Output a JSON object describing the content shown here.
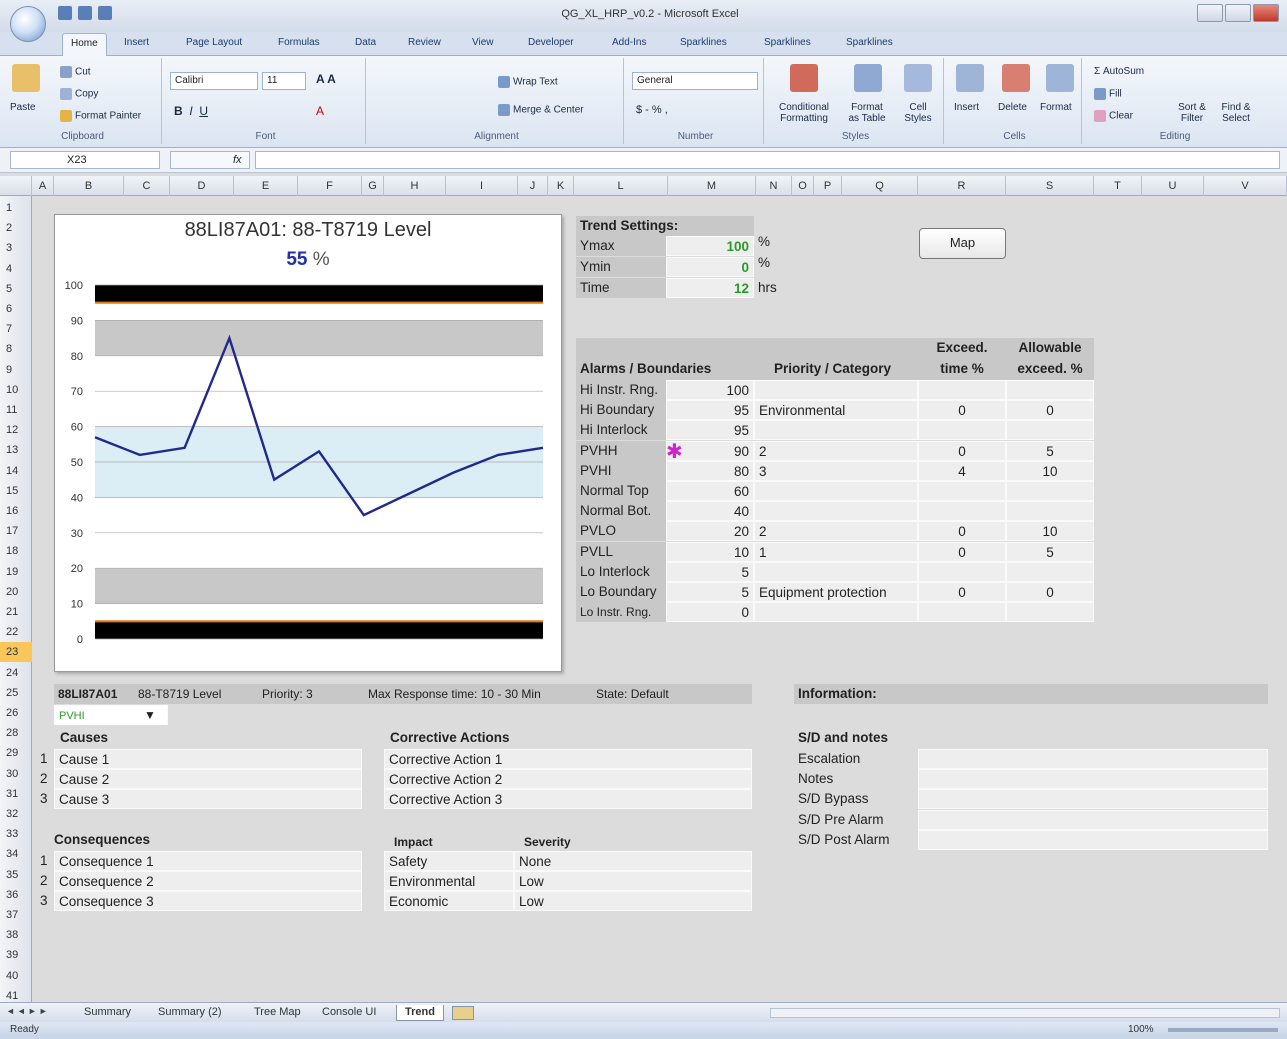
{
  "window": {
    "title": "QG_XL_HRP_v0.2 - Microsoft Excel"
  },
  "ribbon_tabs": [
    "Home",
    "Insert",
    "Page Layout",
    "Formulas",
    "Data",
    "Review",
    "View",
    "Developer",
    "Add-Ins",
    "Sparklines",
    "Sparklines",
    "Sparklines"
  ],
  "ribbon": {
    "clipboard": {
      "paste": "Paste",
      "cut": "Cut",
      "copy": "Copy",
      "format_painter": "Format Painter",
      "label": "Clipboard"
    },
    "font": {
      "name": "Calibri",
      "size": "11",
      "label": "Font"
    },
    "alignment": {
      "wrap": "Wrap Text",
      "merge": "Merge & Center",
      "label": "Alignment"
    },
    "number": {
      "format": "General",
      "label": "Number"
    },
    "styles": {
      "cond": "Conditional",
      "cond2": "Formatting",
      "fmt": "Format",
      "fmt2": "as Table",
      "cell": "Cell",
      "cell2": "Styles",
      "label": "Styles"
    },
    "cells": {
      "insert": "Insert",
      "delete": "Delete",
      "format": "Format",
      "label": "Cells"
    },
    "editing": {
      "autosum": "AutoSum",
      "fill": "Fill",
      "clear": "Clear",
      "sort": "Sort &",
      "sort2": "Filter",
      "find": "Find &",
      "find2": "Select",
      "label": "Editing"
    }
  },
  "formula_bar": {
    "name_box": "X23",
    "fx": "fx"
  },
  "columns": [
    "A",
    "B",
    "C",
    "D",
    "E",
    "F",
    "G",
    "H",
    "I",
    "J",
    "K",
    "L",
    "M",
    "N",
    "O",
    "P",
    "Q",
    "R",
    "S",
    "T",
    "U",
    "V"
  ],
  "rows": [
    "1",
    "2",
    "3",
    "4",
    "5",
    "6",
    "7",
    "8",
    "9",
    "10",
    "11",
    "12",
    "13",
    "14",
    "15",
    "16",
    "17",
    "18",
    "19",
    "20",
    "21",
    "22",
    "23",
    "24",
    "25",
    "26",
    "28",
    "29",
    "30",
    "31",
    "32",
    "33",
    "34",
    "35",
    "36",
    "37",
    "38",
    "39",
    "40",
    "41"
  ],
  "chart_data": {
    "type": "line",
    "title": "88LI87A01:  88-T8719 Level",
    "current_value": "55",
    "current_unit": "%",
    "ylim": [
      0,
      100
    ],
    "yticks": [
      0,
      10,
      20,
      30,
      40,
      50,
      60,
      70,
      80,
      90,
      100
    ],
    "x": [
      0,
      1,
      2,
      3,
      4,
      5,
      6,
      7,
      8,
      9,
      10,
      11,
      12
    ],
    "series": [
      {
        "values": [
          57,
          52,
          54,
          85,
          45,
          53,
          35,
          41,
          47,
          52,
          54
        ]
      }
    ],
    "bands": {
      "normal": [
        40,
        60
      ],
      "pvhi": [
        80,
        90
      ],
      "pvlo": [
        10,
        20
      ],
      "instr_hi": [
        95,
        100
      ],
      "instr_lo": [
        0,
        5
      ]
    },
    "limit_lines": [
      95,
      5
    ],
    "colors": {
      "line": "#1f2a8c",
      "normal_band": "#dbeef5",
      "alarm_band": "#c8c8c8",
      "instr": "#000000",
      "limit": "#e07b1a"
    }
  },
  "trend_settings": {
    "title": "Trend Settings:",
    "rows": [
      {
        "label": "Ymax",
        "value": "100",
        "unit": "%"
      },
      {
        "label": "Ymin",
        "value": "0",
        "unit": "%"
      },
      {
        "label": "Time",
        "value": "12",
        "unit": "hrs"
      }
    ]
  },
  "map_button": "Map",
  "alarms": {
    "header": {
      "col1": "Alarms / Boundaries",
      "col2": "Priority / Category",
      "col3a": "Exceed.",
      "col3b": "time %",
      "col4a": "Allowable",
      "col4b": "exceed. %"
    },
    "rows": [
      {
        "label": "Hi Instr. Rng.",
        "value": "100",
        "priority": "",
        "exceed": "",
        "allow": ""
      },
      {
        "label": "Hi Boundary",
        "value": "95",
        "priority": "Environmental",
        "exceed": "0",
        "allow": "0"
      },
      {
        "label": "Hi Interlock",
        "value": "95",
        "priority": "",
        "exceed": "",
        "allow": ""
      },
      {
        "label": "PVHH",
        "value": "90",
        "priority": "2",
        "exceed": "0",
        "allow": "5"
      },
      {
        "label": "PVHI",
        "value": "80",
        "priority": "3",
        "exceed": "4",
        "allow": "10"
      },
      {
        "label": "Normal Top",
        "value": "60",
        "priority": "",
        "exceed": "",
        "allow": ""
      },
      {
        "label": "Normal Bot.",
        "value": "40",
        "priority": "",
        "exceed": "",
        "allow": ""
      },
      {
        "label": "PVLO",
        "value": "20",
        "priority": "2",
        "exceed": "0",
        "allow": "10"
      },
      {
        "label": "PVLL",
        "value": "10",
        "priority": "1",
        "exceed": "0",
        "allow": "5"
      },
      {
        "label": "Lo Interlock",
        "value": "5",
        "priority": "",
        "exceed": "",
        "allow": ""
      },
      {
        "label": "Lo Boundary",
        "value": "5",
        "priority": "Equipment protection",
        "exceed": "0",
        "allow": "0"
      },
      {
        "label": "Lo Instr. Rng.",
        "value": "0",
        "priority": "",
        "exceed": "",
        "allow": ""
      }
    ],
    "marker": "✱"
  },
  "detail": {
    "tag": "88LI87A01",
    "desc": "88-T8719 Level",
    "priority": "Priority: 3",
    "response": "Max Response time:  10 - 30 Min",
    "state": "State:  Default",
    "selector": "PVHI",
    "causes_title": "Causes",
    "causes": [
      "Cause 1",
      "Cause 2",
      "Cause 3"
    ],
    "actions_title": "Corrective Actions",
    "actions": [
      "Corrective Action 1",
      "Corrective Action 2",
      "Corrective Action 3"
    ],
    "consequences_title": "Consequences",
    "consequences": [
      "Consequence 1",
      "Consequence 2",
      "Consequence 3"
    ],
    "impact_title": "Impact",
    "severity_title": "Severity",
    "impacts": [
      {
        "impact": "Safety",
        "severity": "None"
      },
      {
        "impact": "Environmental",
        "severity": "Low"
      },
      {
        "impact": "Economic",
        "severity": "Low"
      }
    ],
    "nums": [
      "1",
      "2",
      "3"
    ]
  },
  "information": {
    "title": "Information:",
    "notes_title": "S/D and notes",
    "rows": [
      "Escalation",
      "Notes",
      "S/D Bypass",
      "S/D Pre Alarm",
      "S/D Post Alarm"
    ]
  },
  "sheet_tabs": [
    "Summary",
    "Summary (2)",
    "Tree Map",
    "Console UI",
    "Trend"
  ],
  "status": {
    "ready": "Ready",
    "zoom": "100%"
  }
}
